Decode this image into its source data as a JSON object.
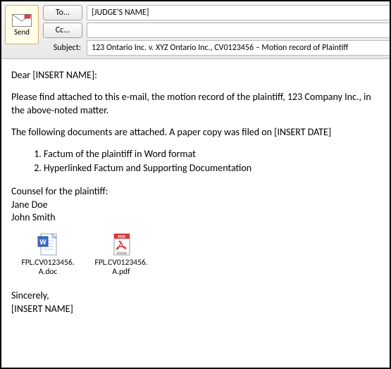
{
  "header": {
    "send_label": "Send",
    "to_button": "To...",
    "cc_button": "Cc...",
    "subject_label": "Subject:",
    "to_value": "[JUDGE'S NAME]",
    "cc_value": "",
    "subject_value": "123 Ontario Inc. v. XYZ Ontario Inc., CV0123456 – Motion record of Plaintiff"
  },
  "body": {
    "greeting": "Dear [INSERT NAME]:",
    "para1": "Please find attached to this e-mail, the motion record of the plaintiff, 123 Company Inc., in the above-noted matter.",
    "para2": "The following documents are attached.  A paper copy was filed on [INSERT DATE]",
    "list": {
      "item1": "Factum of the plaintiff in Word format",
      "item2": "Hyperlinked Factum and Supporting Documentation"
    },
    "counsel_header": "Counsel for the plaintiff:",
    "counsel1": "Jane Doe",
    "counsel2": "John Smith",
    "closing": "Sincerely,",
    "signature": "[INSERT NAME]"
  },
  "attachments": {
    "a1": {
      "line1": "FPL.CV0123456.",
      "line2": "A.doc"
    },
    "a2": {
      "line1": "FPL.CV0123456.",
      "line2": "A.pdf"
    }
  }
}
